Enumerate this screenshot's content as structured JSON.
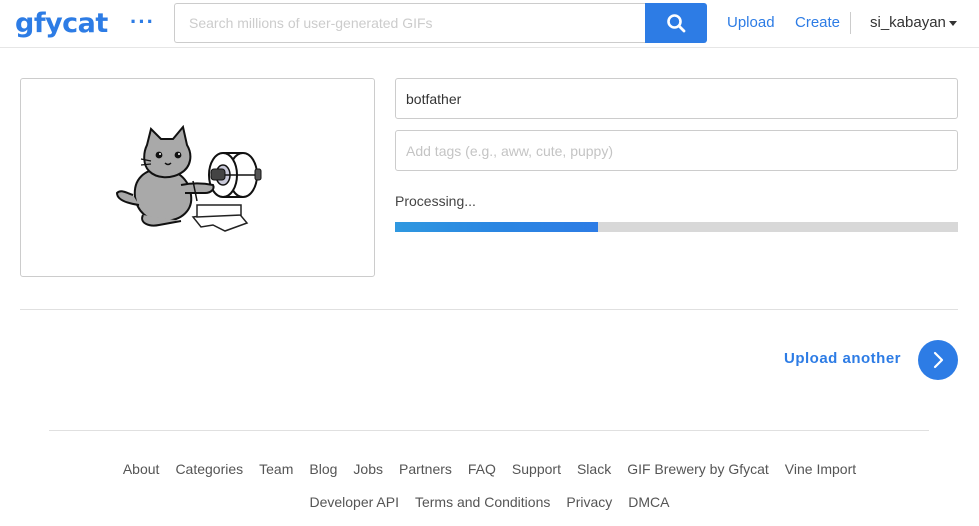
{
  "header": {
    "logo": "gfycat",
    "more_icon": "more-dots-icon",
    "search": {
      "placeholder": "Search millions of user-generated GIFs",
      "value": ""
    },
    "search_icon": "search-icon",
    "nav": {
      "upload": "Upload",
      "create": "Create"
    },
    "user": {
      "name": "si_kabayan"
    }
  },
  "main": {
    "preview": {
      "icon": "cat-toilet-paper-illustration"
    },
    "title_input": {
      "value": "botfather"
    },
    "tags_input": {
      "placeholder": "Add tags (e.g., aww, cute, puppy)",
      "value": ""
    },
    "status": "Processing...",
    "progress": {
      "fraction": 0.36
    },
    "upload_another": "Upload another",
    "next_icon": "chevron-right-icon"
  },
  "footer": {
    "row1": [
      "About",
      "Categories",
      "Team",
      "Blog",
      "Jobs",
      "Partners",
      "FAQ",
      "Support",
      "Slack",
      "GIF Brewery by Gfycat",
      "Vine Import"
    ],
    "row2": [
      "Developer API",
      "Terms and Conditions",
      "Privacy",
      "DMCA"
    ]
  },
  "colors": {
    "accent": "#2d7ce5",
    "progress_track": "#d8d8d8"
  }
}
